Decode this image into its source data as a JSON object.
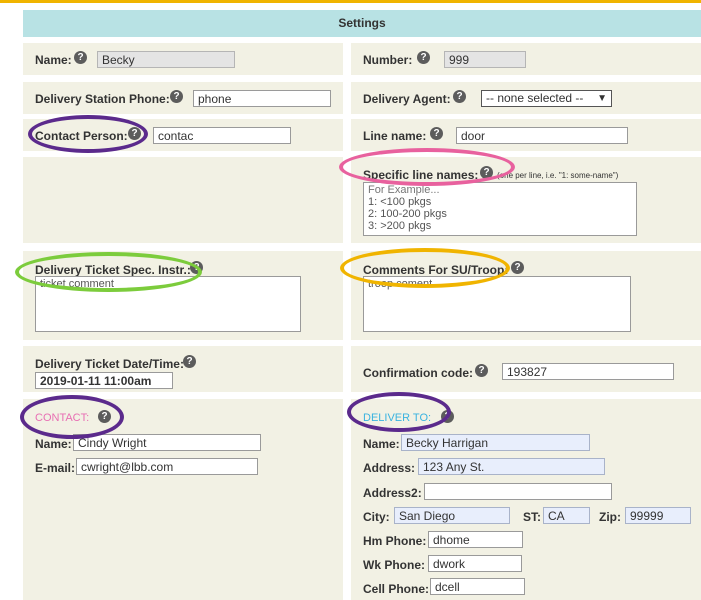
{
  "header": {
    "title": "Settings"
  },
  "fields": {
    "name": {
      "label": "Name:",
      "value": "Becky"
    },
    "number": {
      "label": "Number:",
      "value": "999"
    },
    "station_phone": {
      "label": "Delivery Station Phone:",
      "value": "phone"
    },
    "delivery_agent": {
      "label": "Delivery Agent:",
      "selected": "-- none selected --"
    },
    "contact_person": {
      "label": "Contact Person:",
      "value": "contac"
    },
    "line_name": {
      "label": "Line name:",
      "value": "door"
    },
    "specific_line_names": {
      "label": "Specific line names:",
      "hint": "(one per line, i.e. \"1: some-name\")",
      "lines": [
        "For Example...",
        "1: <100 pkgs",
        "2: 100-200 pkgs",
        "3: >200 pkgs"
      ]
    },
    "ticket_instr": {
      "label": "Delivery Ticket Spec. Instr.:",
      "value": "ticket comment"
    },
    "comments": {
      "label": "Comments For SU/Troop:",
      "value": "troop coment"
    },
    "ticket_datetime": {
      "label": "Delivery Ticket Date/Time:",
      "value": "2019-01-11 11:00am"
    },
    "confirmation": {
      "label": "Confirmation code:",
      "value": "193827"
    }
  },
  "contact": {
    "heading": "CONTACT:",
    "name_label": "Name:",
    "name": "Cindy Wright",
    "email_label": "E-mail:",
    "email": "cwright@lbb.com"
  },
  "deliver_to": {
    "heading": "DELIVER TO:",
    "name_label": "Name:",
    "name": "Becky Harrigan",
    "address_label": "Address:",
    "address": "123 Any St.",
    "address2_label": "Address2:",
    "address2": "",
    "city_label": "City:",
    "city": "San Diego",
    "st_label": "ST:",
    "st": "CA",
    "zip_label": "Zip:",
    "zip": "99999",
    "hm_label": "Hm Phone:",
    "hm": "dhome",
    "wk_label": "Wk Phone:",
    "wk": "dwork",
    "cell_label": "Cell Phone:",
    "cell": "dcell"
  },
  "icons": {
    "help": "?",
    "dropdown": "▼"
  },
  "colors": {
    "header_bg": "#b8e2e4",
    "cell_bg": "#f2f1e4",
    "accent_top": "#f0b400",
    "contact_heading": "#e86fb3",
    "deliver_heading": "#3ab3e0",
    "ring_purple": "#5b2a8c",
    "ring_pink": "#e8619e",
    "ring_green": "#7ccc3c",
    "ring_yellow": "#f0b400"
  }
}
